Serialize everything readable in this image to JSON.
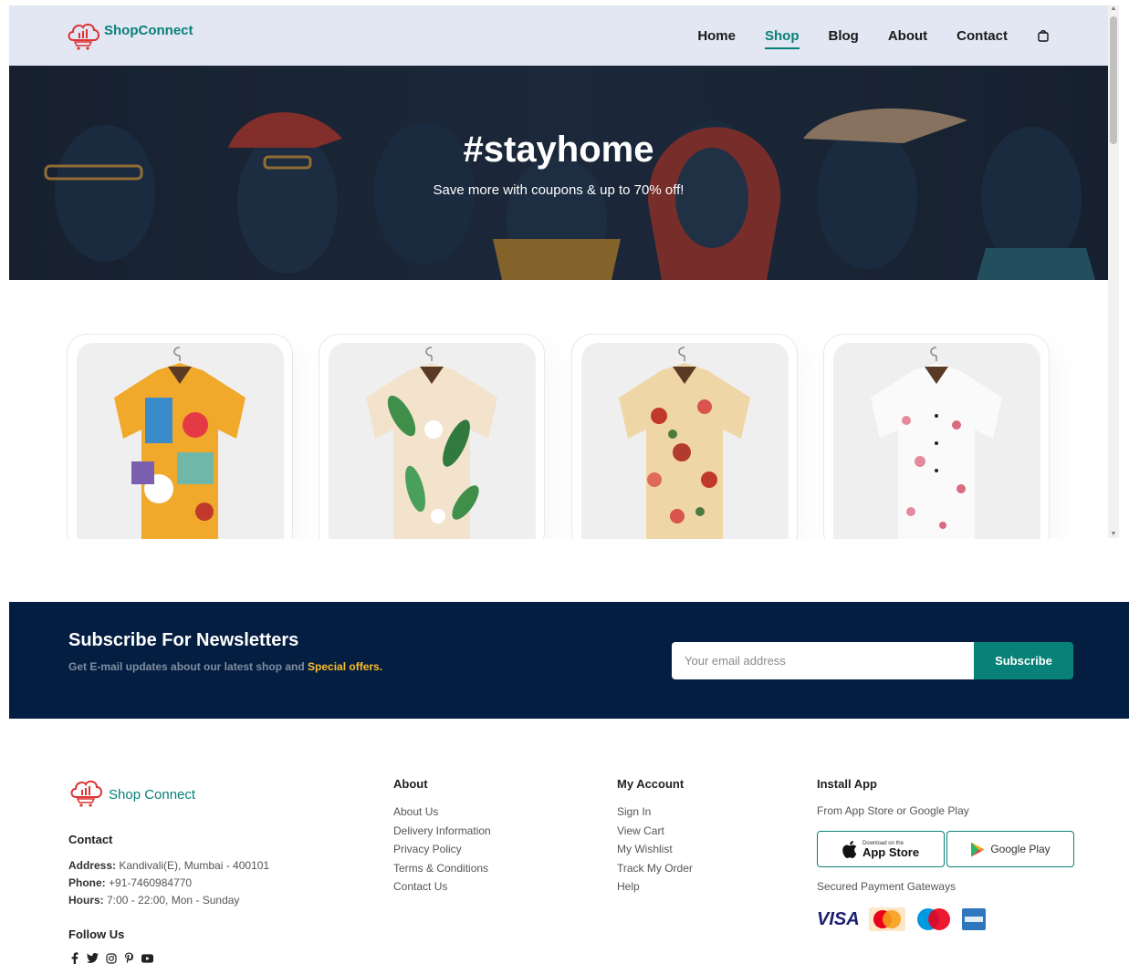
{
  "header": {
    "brand": "ShopConnect",
    "nav": [
      {
        "label": "Home",
        "active": false
      },
      {
        "label": "Shop",
        "active": true
      },
      {
        "label": "Blog",
        "active": false
      },
      {
        "label": "About",
        "active": false
      },
      {
        "label": "Contact",
        "active": false
      }
    ],
    "cart_icon": "shopping-bag-icon",
    "accent_color": "#088178",
    "background": "#e3e6f3"
  },
  "hero": {
    "title": "#stayhome",
    "subtitle": "Save more with coupons & up to 70% off!"
  },
  "products": [
    {
      "image": "colorful-abstract-print-shirt"
    },
    {
      "image": "green-leaf-floral-shirt"
    },
    {
      "image": "red-floral-beige-shirt"
    },
    {
      "image": "pink-blossom-white-shirt"
    }
  ],
  "newsletter": {
    "title": "Subscribe For Newsletters",
    "subtitle_prefix": "Get E-mail updates about our latest shop and ",
    "subtitle_highlight": "Special offers.",
    "placeholder": "Your email address",
    "button": "Subscribe",
    "highlight_color": "#ffbd27",
    "background": "#041e42"
  },
  "footer": {
    "brand": "Shop Connect",
    "contact_heading": "Contact",
    "address_label": "Address:",
    "address_value": " Kandivali(E), Mumbai - 400101",
    "phone_label": "Phone:",
    "phone_value": " +91-7460984770",
    "hours_label": "Hours:",
    "hours_value": " 7:00 - 22:00, Mon - Sunday",
    "follow_heading": "Follow Us",
    "social_icons": [
      "facebook-icon",
      "twitter-icon",
      "instagram-icon",
      "pinterest-icon",
      "youtube-icon"
    ],
    "about_heading": "About",
    "about_links": [
      "About Us",
      "Delivery Information",
      "Privacy Policy",
      "Terms & Conditions",
      "Contact Us"
    ],
    "account_heading": "My Account",
    "account_links": [
      "Sign In",
      "View Cart",
      "My Wishlist",
      "Track My Order",
      "Help"
    ],
    "install_heading": "Install App",
    "install_sub": "From App Store or Google Play",
    "appstore_small": "Download on the",
    "appstore_big": "App Store",
    "googleplay": "Google Play",
    "payment_heading": "Secured Payment Gateways",
    "payment_icons": [
      "visa-icon",
      "mastercard-icon",
      "maestro-icon",
      "amex-icon"
    ],
    "visa_text": "VISA"
  }
}
